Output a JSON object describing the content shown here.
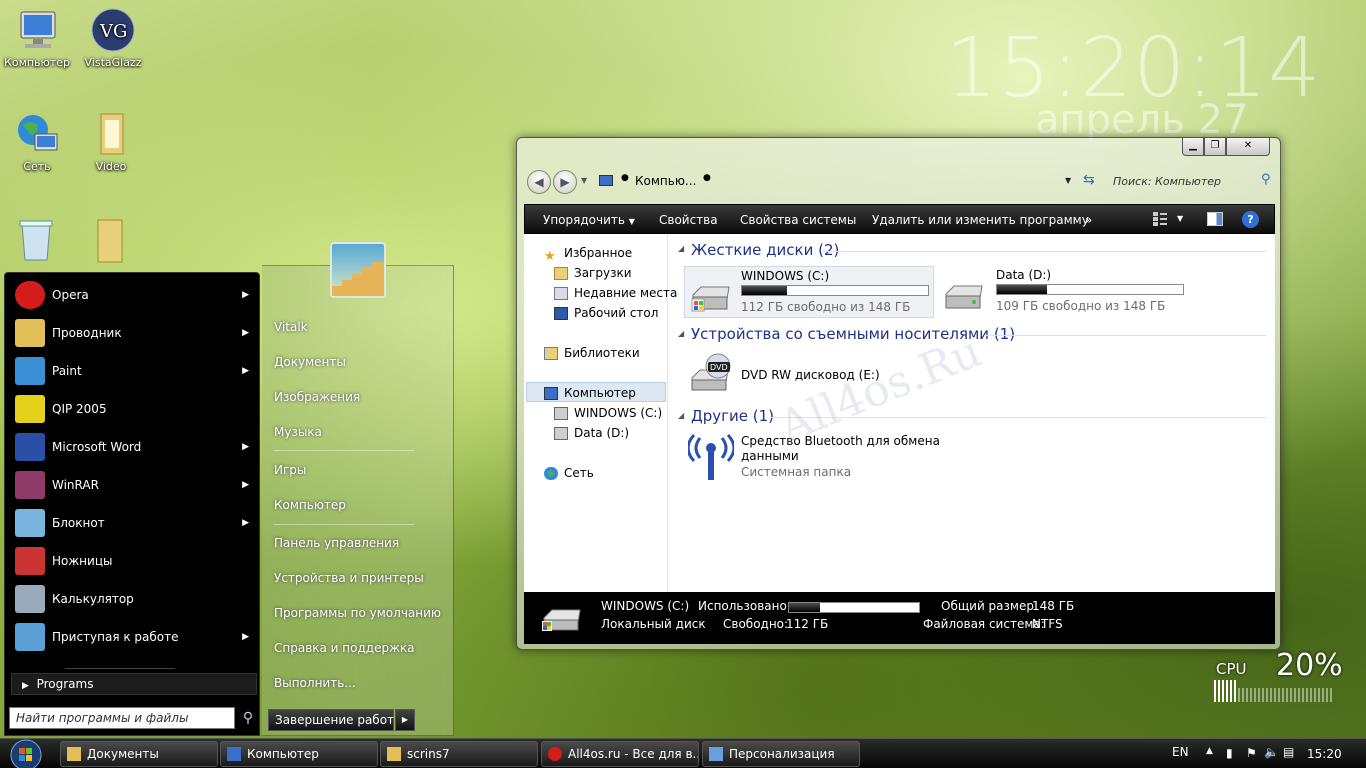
{
  "desktop": {
    "icons": [
      {
        "label": "Компьютер",
        "icon": "computer-icon"
      },
      {
        "label": "VistaGlazz",
        "icon": "vistaglazz-icon"
      },
      {
        "label": "Сеть",
        "icon": "network-icon"
      },
      {
        "label": "Video",
        "icon": "folder-icon"
      }
    ],
    "clock_time": "15:20:14",
    "clock_date": "апрель 27",
    "watermark": "All4os.Ru"
  },
  "explorer": {
    "breadcrumb": "Компью...",
    "search_placeholder": "Поиск: Компьютер",
    "toolbar": {
      "organize": "Упорядочить",
      "properties": "Свойства",
      "system_properties": "Свойства системы",
      "uninstall": "Удалить или изменить программу",
      "more": "»"
    },
    "nav": {
      "favorites": "Избранное",
      "downloads": "Загрузки",
      "recent": "Недавние места",
      "desktop": "Рабочий стол",
      "libraries": "Библиотеки",
      "computer": "Компьютер",
      "drive_c": "WINDOWS (C:)",
      "drive_d": "Data (D:)",
      "network": "Сеть"
    },
    "sections": {
      "hdd": "Жесткие диски (2)",
      "removable": "Устройства со съемными носителями (1)",
      "other": "Другие (1)"
    },
    "drives": [
      {
        "name": "WINDOWS (C:)",
        "free": "112 ГБ свободно из 148 ГБ",
        "used_fraction": 0.24
      },
      {
        "name": "Data (D:)",
        "free": "109 ГБ свободно из 148 ГБ",
        "used_fraction": 0.27
      }
    ],
    "dvd": {
      "name": "DVD RW дисковод (E:)",
      "badge": "DVD"
    },
    "bluetooth": {
      "name_line1": "Средство Bluetooth для обмена",
      "name_line2": "данными",
      "type": "Системная папка"
    },
    "status": {
      "name": "WINDOWS (C:)",
      "type": "Локальный диск",
      "used_label": "Использовано:",
      "used_fraction": 0.24,
      "free_label": "Свободно:",
      "free_value": "112 ГБ",
      "total_label": "Общий размер:",
      "total_value": "148 ГБ",
      "fs_label": "Файловая система:",
      "fs_value": "NTFS"
    }
  },
  "start_menu": {
    "items": [
      {
        "label": "Opera",
        "icon": "opera-icon",
        "arrow": true
      },
      {
        "label": "Проводник",
        "icon": "explorer-icon",
        "arrow": true
      },
      {
        "label": "Paint",
        "icon": "paint-icon",
        "arrow": true
      },
      {
        "label": "QIP 2005",
        "icon": "qip-icon",
        "arrow": false
      },
      {
        "label": "Microsoft Word",
        "icon": "word-icon",
        "arrow": true
      },
      {
        "label": "WinRAR",
        "icon": "winrar-icon",
        "arrow": true
      },
      {
        "label": "Блокнот",
        "icon": "notepad-icon",
        "arrow": true
      },
      {
        "label": "Ножницы",
        "icon": "scissors-icon",
        "arrow": false
      },
      {
        "label": "Калькулятор",
        "icon": "calculator-icon",
        "arrow": false
      },
      {
        "label": "Приступая к работе",
        "icon": "getting-started-icon",
        "arrow": true
      }
    ],
    "programs": "Programs",
    "search_placeholder": "Найти программы и файлы",
    "right": {
      "user": "Vitalk",
      "documents": "Документы",
      "pictures": "Изображения",
      "music": "Музыка",
      "games": "Игры",
      "computer": "Компьютер",
      "control_panel": "Панель управления",
      "devices": "Устройства и принтеры",
      "defaults": "Программы по умолчанию",
      "help": "Справка и поддержка",
      "run": "Выполнить...",
      "shutdown": "Завершение работы"
    }
  },
  "taskbar": {
    "buttons": [
      {
        "label": "Документы",
        "icon": "folder-icon"
      },
      {
        "label": "Компьютер",
        "icon": "computer-icon"
      },
      {
        "label": "scrins7",
        "icon": "folder-icon"
      },
      {
        "label": "All4os.ru - Все для в...",
        "icon": "opera-icon"
      },
      {
        "label": "Персонализация",
        "icon": "personalization-icon"
      }
    ],
    "lang": "EN",
    "time": "15:20"
  },
  "cpu_gadget": {
    "label": "CPU",
    "value": "20%",
    "percent": 20
  },
  "colors": {
    "accent": "#1e3287",
    "toolbar": "#1a1a1a",
    "taskbar": "#111111"
  }
}
